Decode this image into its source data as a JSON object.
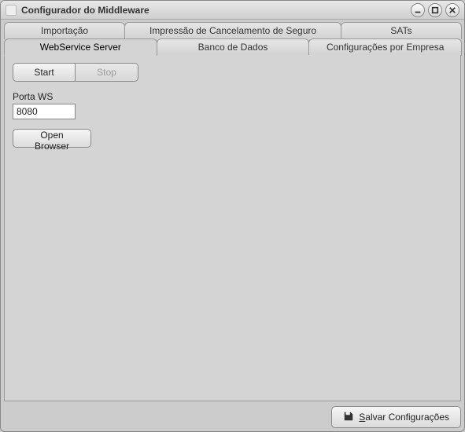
{
  "window": {
    "title": "Configurador do Middleware"
  },
  "tabs_row1": [
    {
      "label": "Importação"
    },
    {
      "label": "Impressão de Cancelamento de Seguro"
    },
    {
      "label": "SATs"
    }
  ],
  "tabs_row2": [
    {
      "label": "WebService Server",
      "active": true
    },
    {
      "label": "Banco de Dados"
    },
    {
      "label": "Configurações por Empresa"
    }
  ],
  "panel": {
    "start_label": "Start",
    "stop_label": "Stop",
    "port_label": "Porta WS",
    "port_value": "8080",
    "open_browser_label": "Open Browser"
  },
  "footer": {
    "save_prefix": "S",
    "save_rest": "alvar Configurações"
  }
}
